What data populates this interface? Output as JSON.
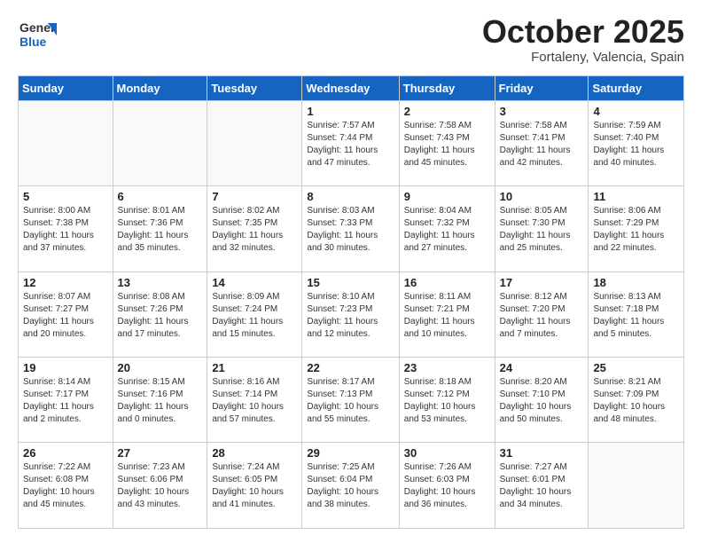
{
  "header": {
    "logo_line1": "General",
    "logo_line2": "Blue",
    "month": "October 2025",
    "location": "Fortaleny, Valencia, Spain"
  },
  "weekdays": [
    "Sunday",
    "Monday",
    "Tuesday",
    "Wednesday",
    "Thursday",
    "Friday",
    "Saturday"
  ],
  "weeks": [
    [
      {
        "day": "",
        "info": ""
      },
      {
        "day": "",
        "info": ""
      },
      {
        "day": "",
        "info": ""
      },
      {
        "day": "1",
        "info": "Sunrise: 7:57 AM\nSunset: 7:44 PM\nDaylight: 11 hours\nand 47 minutes."
      },
      {
        "day": "2",
        "info": "Sunrise: 7:58 AM\nSunset: 7:43 PM\nDaylight: 11 hours\nand 45 minutes."
      },
      {
        "day": "3",
        "info": "Sunrise: 7:58 AM\nSunset: 7:41 PM\nDaylight: 11 hours\nand 42 minutes."
      },
      {
        "day": "4",
        "info": "Sunrise: 7:59 AM\nSunset: 7:40 PM\nDaylight: 11 hours\nand 40 minutes."
      }
    ],
    [
      {
        "day": "5",
        "info": "Sunrise: 8:00 AM\nSunset: 7:38 PM\nDaylight: 11 hours\nand 37 minutes."
      },
      {
        "day": "6",
        "info": "Sunrise: 8:01 AM\nSunset: 7:36 PM\nDaylight: 11 hours\nand 35 minutes."
      },
      {
        "day": "7",
        "info": "Sunrise: 8:02 AM\nSunset: 7:35 PM\nDaylight: 11 hours\nand 32 minutes."
      },
      {
        "day": "8",
        "info": "Sunrise: 8:03 AM\nSunset: 7:33 PM\nDaylight: 11 hours\nand 30 minutes."
      },
      {
        "day": "9",
        "info": "Sunrise: 8:04 AM\nSunset: 7:32 PM\nDaylight: 11 hours\nand 27 minutes."
      },
      {
        "day": "10",
        "info": "Sunrise: 8:05 AM\nSunset: 7:30 PM\nDaylight: 11 hours\nand 25 minutes."
      },
      {
        "day": "11",
        "info": "Sunrise: 8:06 AM\nSunset: 7:29 PM\nDaylight: 11 hours\nand 22 minutes."
      }
    ],
    [
      {
        "day": "12",
        "info": "Sunrise: 8:07 AM\nSunset: 7:27 PM\nDaylight: 11 hours\nand 20 minutes."
      },
      {
        "day": "13",
        "info": "Sunrise: 8:08 AM\nSunset: 7:26 PM\nDaylight: 11 hours\nand 17 minutes."
      },
      {
        "day": "14",
        "info": "Sunrise: 8:09 AM\nSunset: 7:24 PM\nDaylight: 11 hours\nand 15 minutes."
      },
      {
        "day": "15",
        "info": "Sunrise: 8:10 AM\nSunset: 7:23 PM\nDaylight: 11 hours\nand 12 minutes."
      },
      {
        "day": "16",
        "info": "Sunrise: 8:11 AM\nSunset: 7:21 PM\nDaylight: 11 hours\nand 10 minutes."
      },
      {
        "day": "17",
        "info": "Sunrise: 8:12 AM\nSunset: 7:20 PM\nDaylight: 11 hours\nand 7 minutes."
      },
      {
        "day": "18",
        "info": "Sunrise: 8:13 AM\nSunset: 7:18 PM\nDaylight: 11 hours\nand 5 minutes."
      }
    ],
    [
      {
        "day": "19",
        "info": "Sunrise: 8:14 AM\nSunset: 7:17 PM\nDaylight: 11 hours\nand 2 minutes."
      },
      {
        "day": "20",
        "info": "Sunrise: 8:15 AM\nSunset: 7:16 PM\nDaylight: 11 hours\nand 0 minutes."
      },
      {
        "day": "21",
        "info": "Sunrise: 8:16 AM\nSunset: 7:14 PM\nDaylight: 10 hours\nand 57 minutes."
      },
      {
        "day": "22",
        "info": "Sunrise: 8:17 AM\nSunset: 7:13 PM\nDaylight: 10 hours\nand 55 minutes."
      },
      {
        "day": "23",
        "info": "Sunrise: 8:18 AM\nSunset: 7:12 PM\nDaylight: 10 hours\nand 53 minutes."
      },
      {
        "day": "24",
        "info": "Sunrise: 8:20 AM\nSunset: 7:10 PM\nDaylight: 10 hours\nand 50 minutes."
      },
      {
        "day": "25",
        "info": "Sunrise: 8:21 AM\nSunset: 7:09 PM\nDaylight: 10 hours\nand 48 minutes."
      }
    ],
    [
      {
        "day": "26",
        "info": "Sunrise: 7:22 AM\nSunset: 6:08 PM\nDaylight: 10 hours\nand 45 minutes."
      },
      {
        "day": "27",
        "info": "Sunrise: 7:23 AM\nSunset: 6:06 PM\nDaylight: 10 hours\nand 43 minutes."
      },
      {
        "day": "28",
        "info": "Sunrise: 7:24 AM\nSunset: 6:05 PM\nDaylight: 10 hours\nand 41 minutes."
      },
      {
        "day": "29",
        "info": "Sunrise: 7:25 AM\nSunset: 6:04 PM\nDaylight: 10 hours\nand 38 minutes."
      },
      {
        "day": "30",
        "info": "Sunrise: 7:26 AM\nSunset: 6:03 PM\nDaylight: 10 hours\nand 36 minutes."
      },
      {
        "day": "31",
        "info": "Sunrise: 7:27 AM\nSunset: 6:01 PM\nDaylight: 10 hours\nand 34 minutes."
      },
      {
        "day": "",
        "info": ""
      }
    ]
  ]
}
